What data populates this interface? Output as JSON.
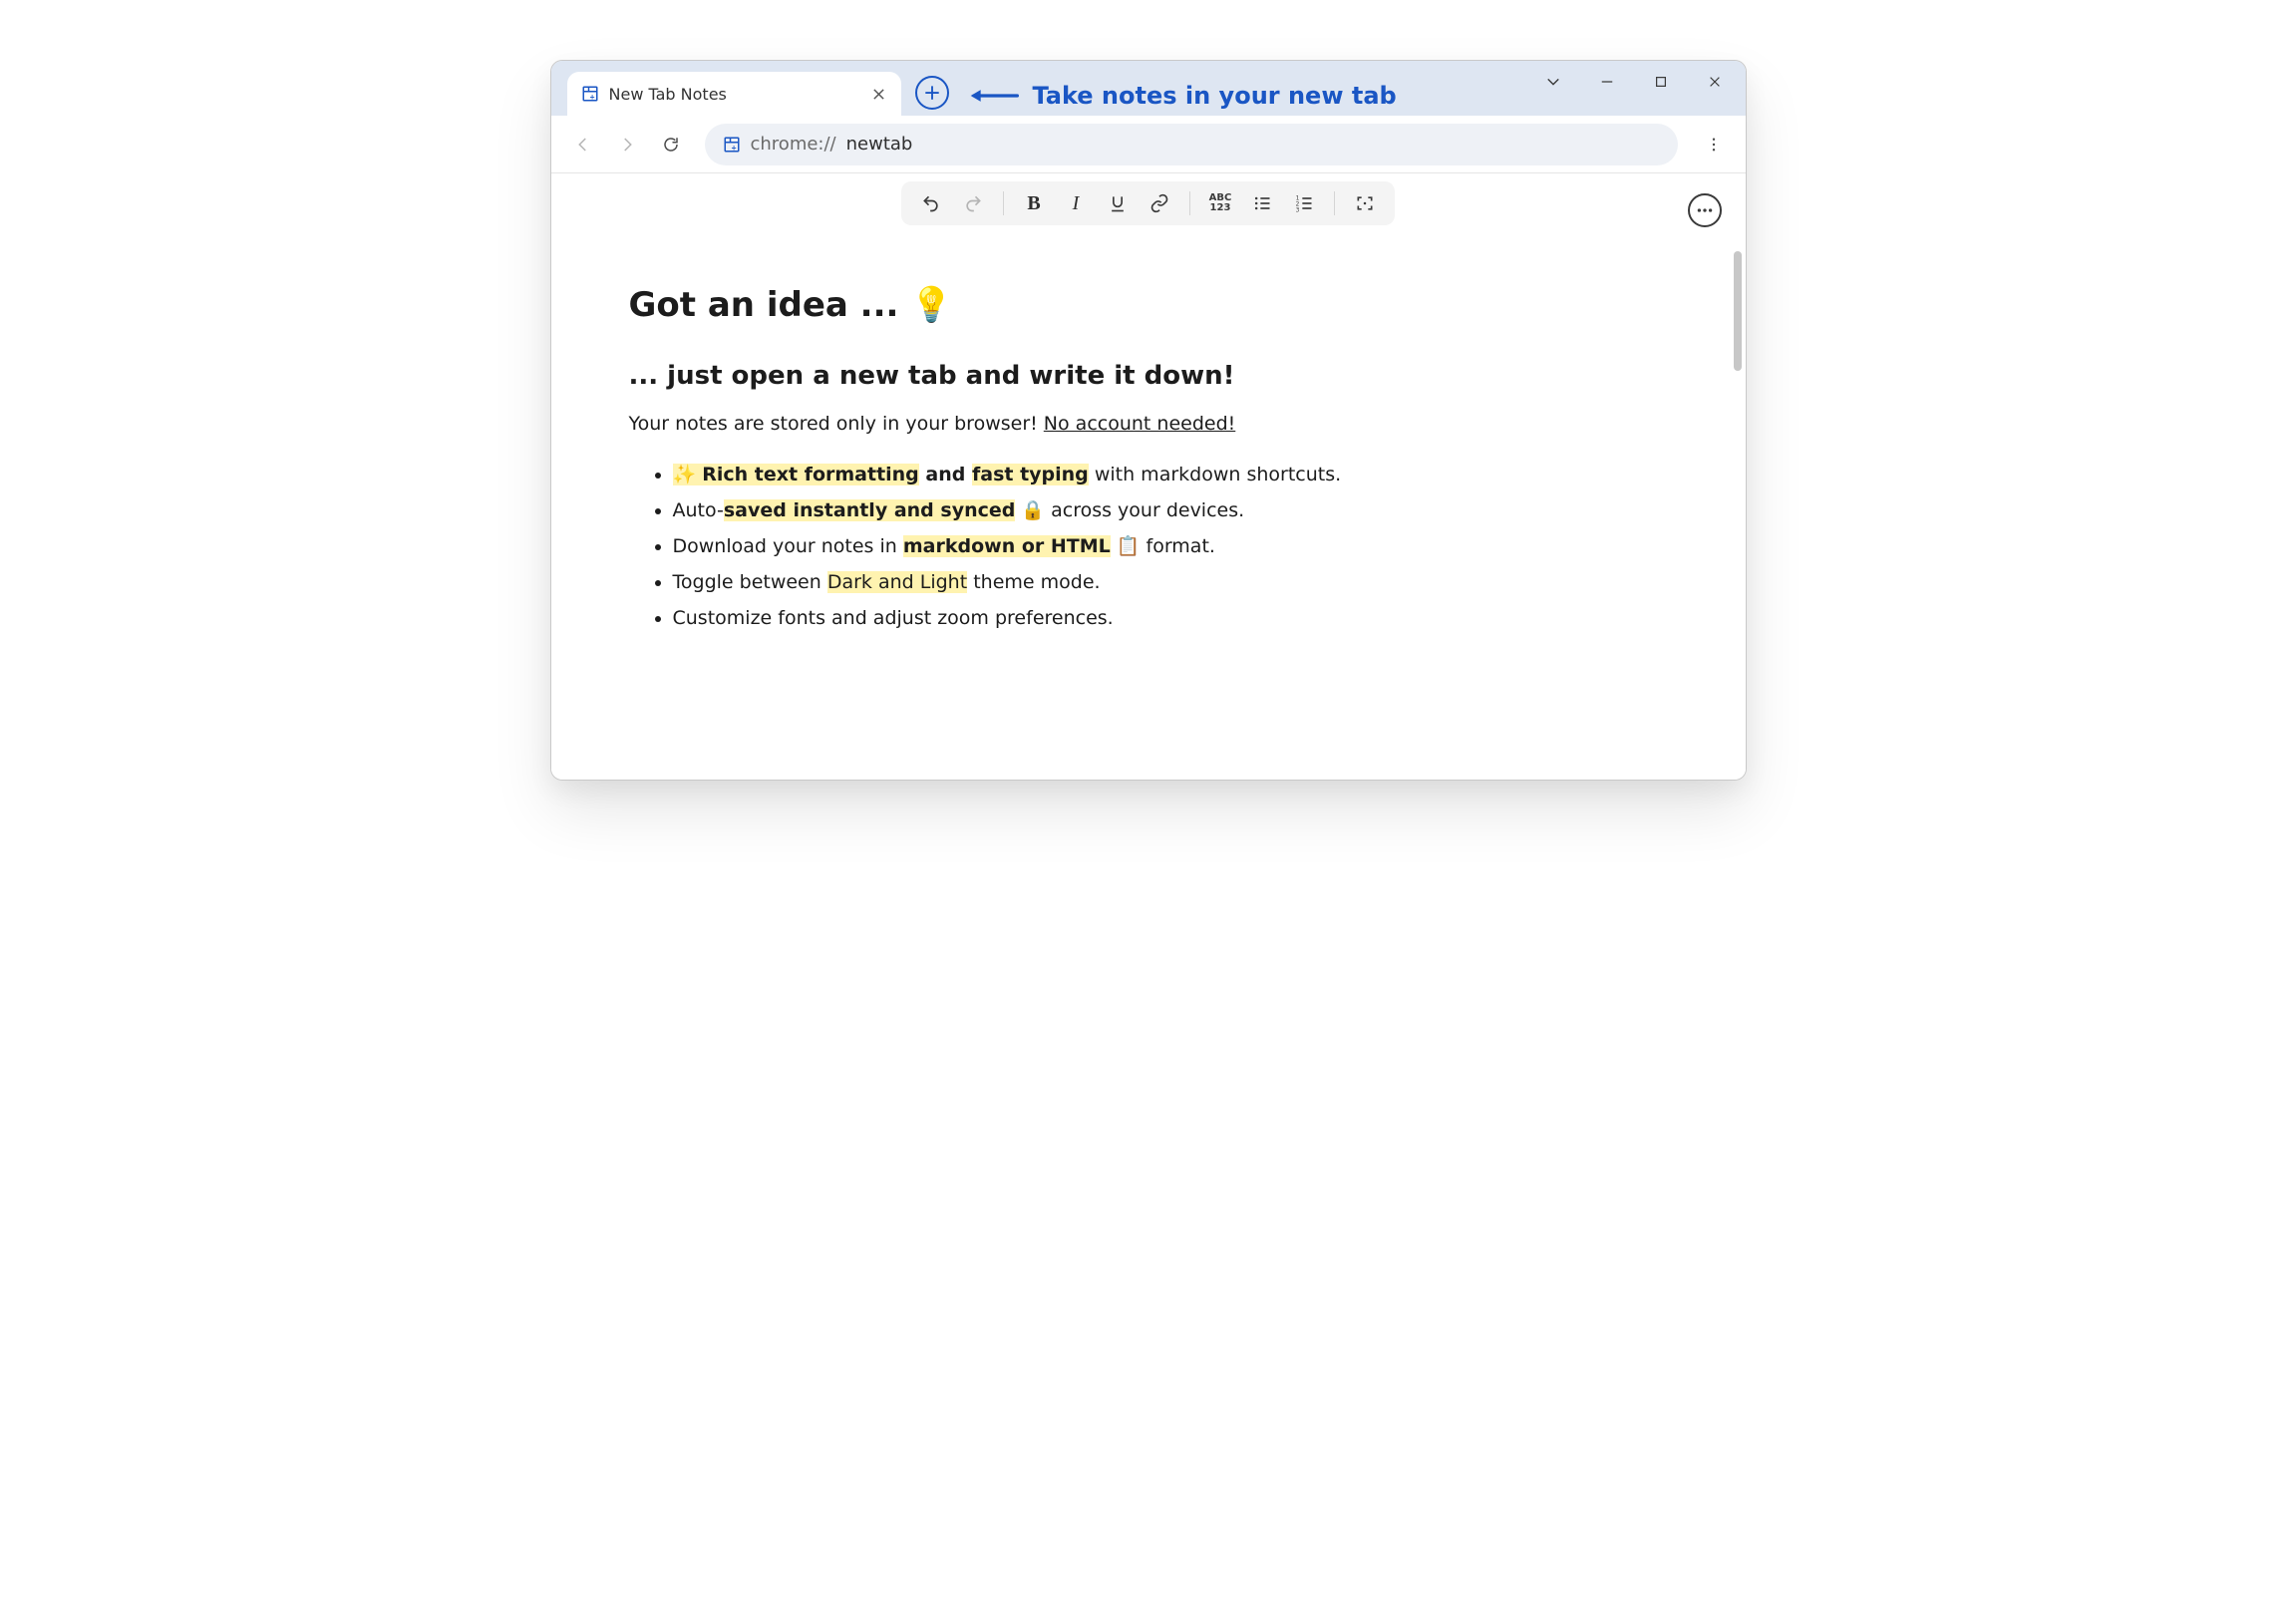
{
  "tab": {
    "title": "New Tab Notes"
  },
  "annotation": {
    "text": "Take notes in your new tab"
  },
  "addressbar": {
    "scheme": "chrome://",
    "path": "newtab"
  },
  "note": {
    "h1": "Got an idea ...  💡",
    "h2": "... just open a new tab and write it down!",
    "intro_plain": "Your notes are stored only in your browser! ",
    "intro_underline": "No account needed!",
    "bullets": {
      "b1": {
        "pre": "✨ ",
        "hl1": "Rich text formatting",
        "mid": " and ",
        "hl2": "fast typing",
        "post": " with markdown shortcuts."
      },
      "b2": {
        "pre": "Auto-",
        "hl": "saved instantly and synced",
        "icon": " 🔒 ",
        "post": "across your devices."
      },
      "b3": {
        "pre": "Download your notes in ",
        "hl": "markdown or HTML",
        "icon": " 📋 ",
        "post": "format."
      },
      "b4": {
        "pre": "Toggle between ",
        "hl": "Dark and Light",
        "post": " theme mode."
      },
      "b5": {
        "text": "Customize fonts and adjust zoom preferences."
      }
    }
  }
}
